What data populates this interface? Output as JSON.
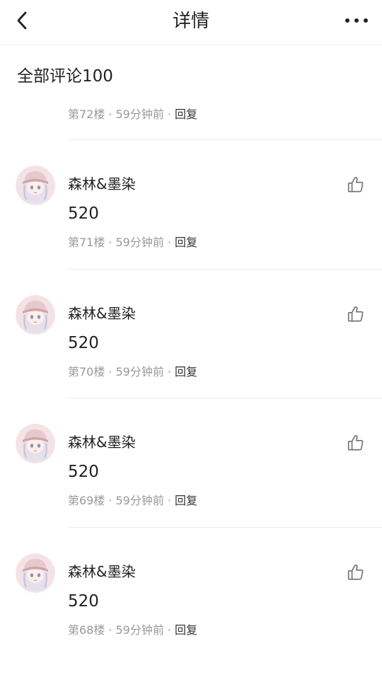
{
  "header": {
    "title": "详情"
  },
  "section_title": "全部评论100",
  "first_meta": {
    "floor": "第72楼",
    "time": "59分钟前",
    "reply": "回复"
  },
  "meta_separator": "·",
  "comments": [
    {
      "username": "森林&墨染",
      "content": "520",
      "floor": "第71楼",
      "time": "59分钟前",
      "reply": "回复"
    },
    {
      "username": "森林&墨染",
      "content": "520",
      "floor": "第70楼",
      "time": "59分钟前",
      "reply": "回复"
    },
    {
      "username": "森林&墨染",
      "content": "520",
      "floor": "第69楼",
      "time": "59分钟前",
      "reply": "回复"
    },
    {
      "username": "森林&墨染",
      "content": "520",
      "floor": "第68楼",
      "time": "59分钟前",
      "reply": "回复"
    }
  ],
  "icons": {
    "back": "chevron-left-icon",
    "more": "more-horizontal-icon",
    "like": "thumbs-up-icon"
  },
  "colors": {
    "text": "#222222",
    "meta": "#999999",
    "reply": "#333333",
    "divider": "#eeeeee",
    "icon": "#777777",
    "background": "#ffffff"
  }
}
